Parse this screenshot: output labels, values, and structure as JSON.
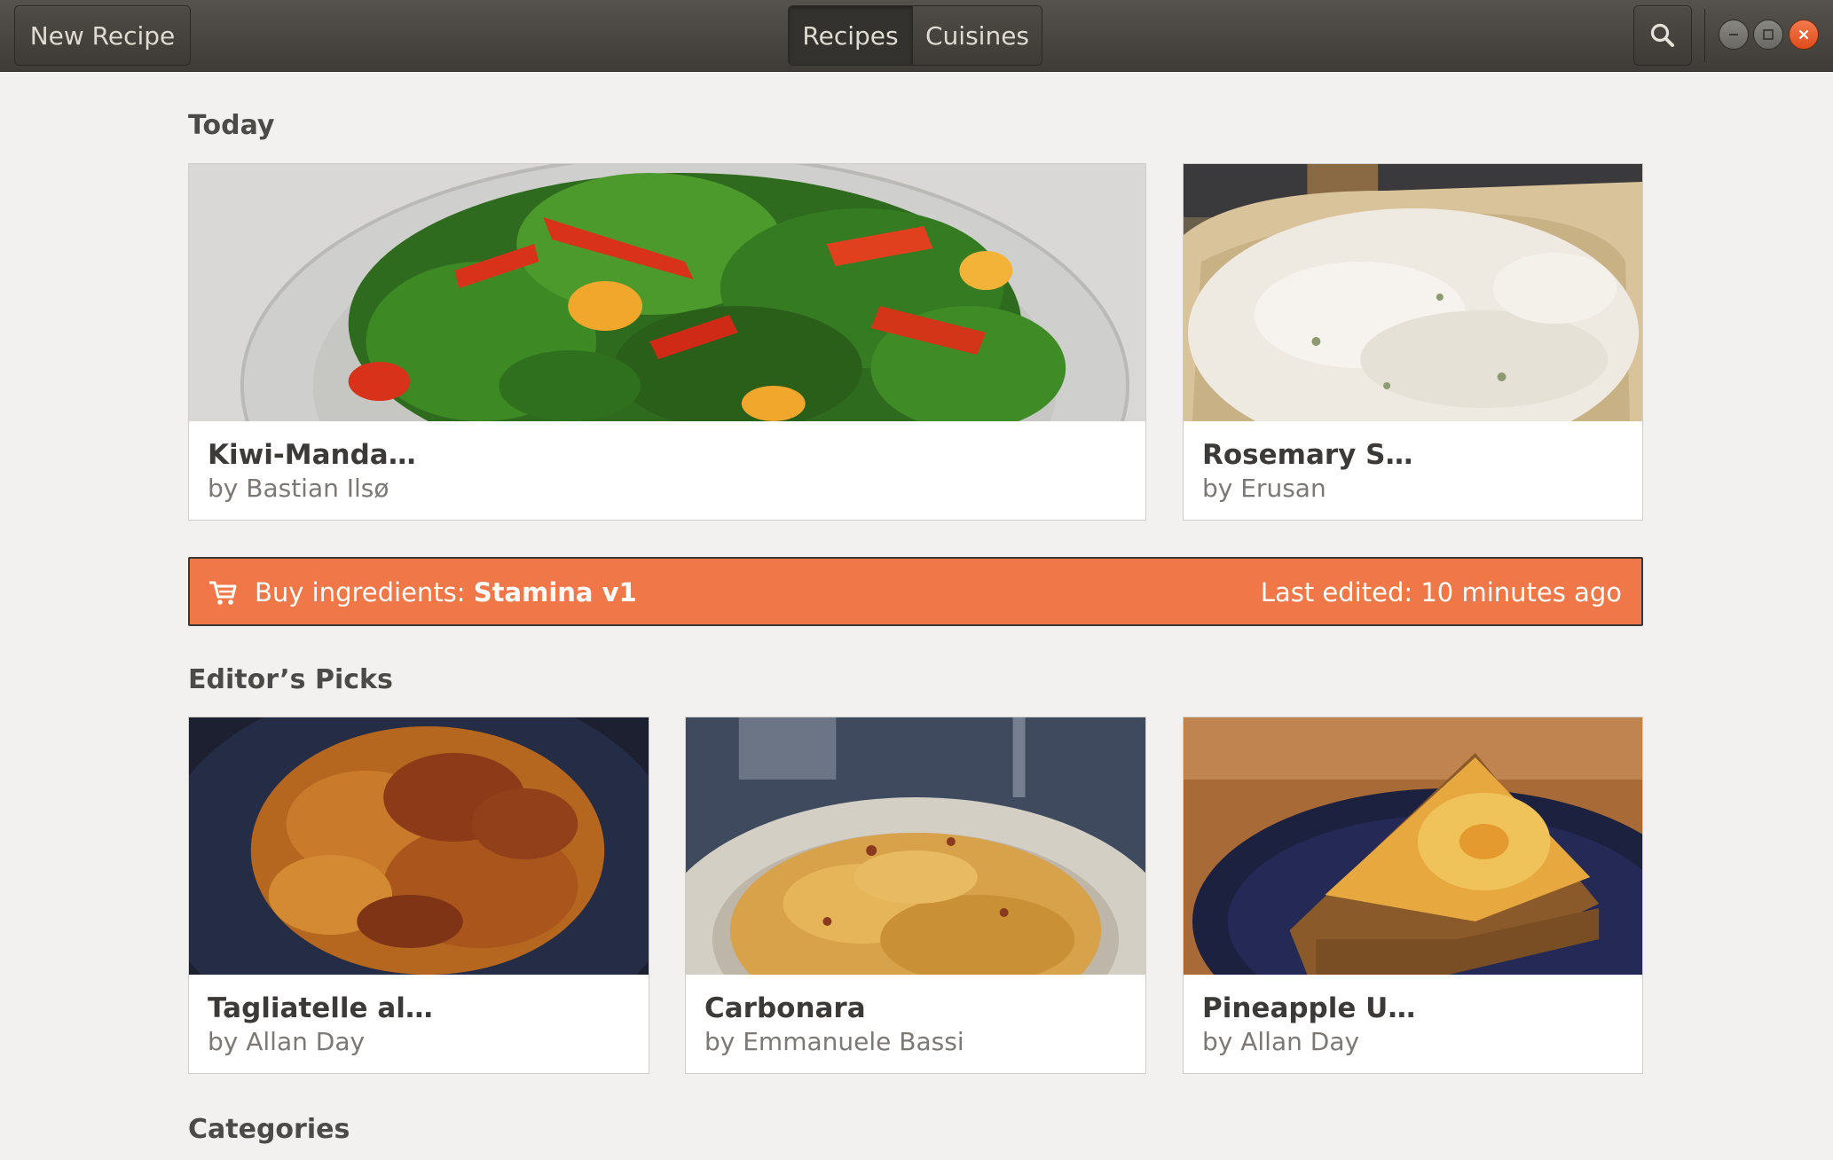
{
  "header": {
    "new_recipe_label": "New Recipe",
    "tabs": [
      {
        "label": "Recipes",
        "active": true
      },
      {
        "label": "Cuisines",
        "active": false
      }
    ],
    "search_icon": "search-icon",
    "window_controls": [
      "minimize-icon",
      "maximize-icon",
      "close-icon"
    ]
  },
  "sections": {
    "today": "Today",
    "editors_picks": "Editor’s Picks",
    "categories": "Categories"
  },
  "today": [
    {
      "title": "Kiwi-Manda…",
      "author": "by Bastian Ilsø"
    },
    {
      "title": "Rosemary S…",
      "author": "by Erusan"
    }
  ],
  "shopping": {
    "icon": "cart-icon",
    "prefix": "Buy ingredients: ",
    "list_name": "Stamina v1",
    "last_edited": "Last edited: 10 minutes ago"
  },
  "picks": [
    {
      "title": "Tagliatelle al…",
      "author": "by Allan Day"
    },
    {
      "title": "Carbonara",
      "author": "by Emmanuele Bassi"
    },
    {
      "title": "Pineapple U…",
      "author": "by Allan Day"
    }
  ],
  "colors": {
    "banner": "#ef7748",
    "header": "#46433f",
    "background": "#f2f1f0",
    "close_button": "#e95420"
  }
}
